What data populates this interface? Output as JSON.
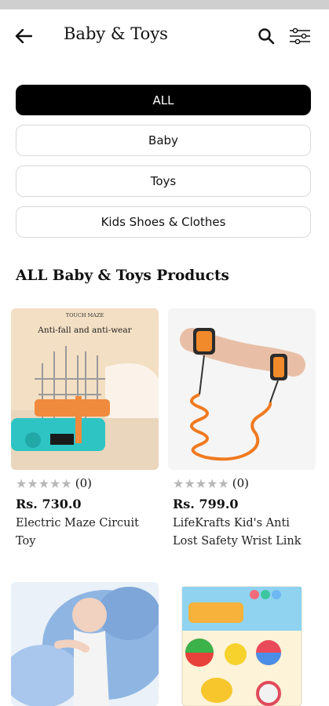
{
  "header": {
    "title": "Baby & Toys",
    "back_icon": "arrow-left-icon",
    "search_icon": "search-icon",
    "filter_icon": "sliders-icon"
  },
  "categories": [
    {
      "label": "ALL",
      "active": true
    },
    {
      "label": "Baby",
      "active": false
    },
    {
      "label": "Toys",
      "active": false
    },
    {
      "label": "Kids Shoes & Clothes",
      "active": false
    }
  ],
  "section_title": "ALL Baby & Toys Products",
  "products": [
    {
      "name": "Electric Maze Circuit Toy",
      "price": "Rs. 730.0",
      "rating_count": "(0)",
      "stars": 0,
      "image_label_top": "TOUCH MAZE",
      "image_label_main": "Anti-fall and anti-wear"
    },
    {
      "name": "LifeKrafts Kid's Anti Lost Safety Wrist Link",
      "price": "Rs. 799.0",
      "rating_count": "(0)",
      "stars": 0
    },
    {
      "name": "",
      "price": "",
      "rating_count": "",
      "stars": 0
    },
    {
      "name": "",
      "price": "",
      "rating_count": "",
      "stars": 0
    }
  ],
  "colors": {
    "active_chip_bg": "#000000",
    "chip_border": "#d9d9d9",
    "star_empty": "#b8b8b8"
  }
}
